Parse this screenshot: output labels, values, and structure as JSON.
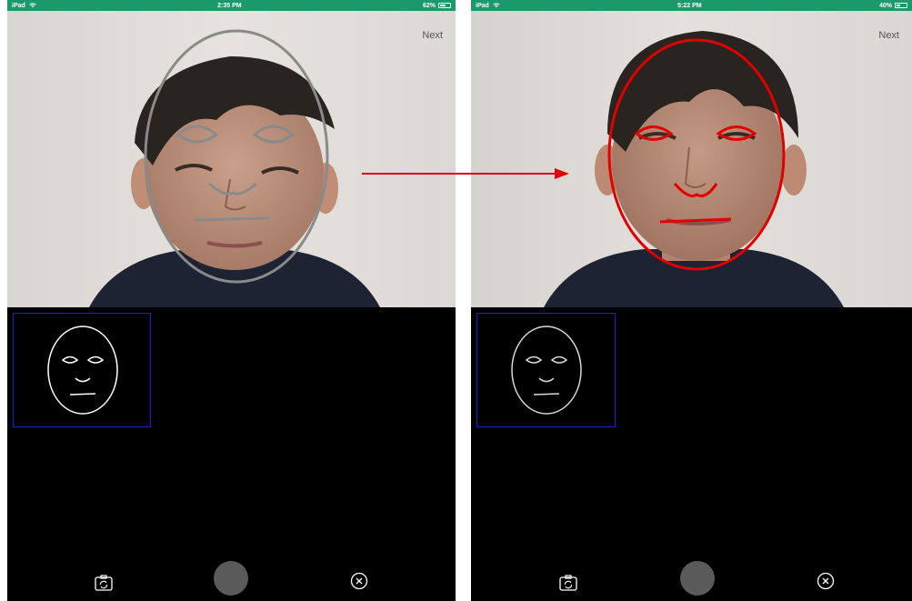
{
  "left_screen": {
    "status": {
      "carrier": "iPad",
      "time": "2:35 PM",
      "battery": "62%",
      "battery_level": 0.62
    },
    "next_label": "Next",
    "overlay_color": "#8a8a8a",
    "status_color": "#1a9a6a"
  },
  "right_screen": {
    "status": {
      "carrier": "iPad",
      "time": "5:22 PM",
      "battery": "40%",
      "battery_level": 0.4
    },
    "next_label": "Next",
    "overlay_color": "#e00000",
    "status_color": "#1a9a6a"
  },
  "icons": {
    "wifi": "wifi-icon",
    "battery": "battery-icon",
    "switch_camera": "switch-camera-icon",
    "shutter": "shutter-icon",
    "close": "close-circle-icon",
    "face_template": "face-outline-icon"
  },
  "arrow_color": "#e00000",
  "preview_border_color": "#1f1fcf"
}
